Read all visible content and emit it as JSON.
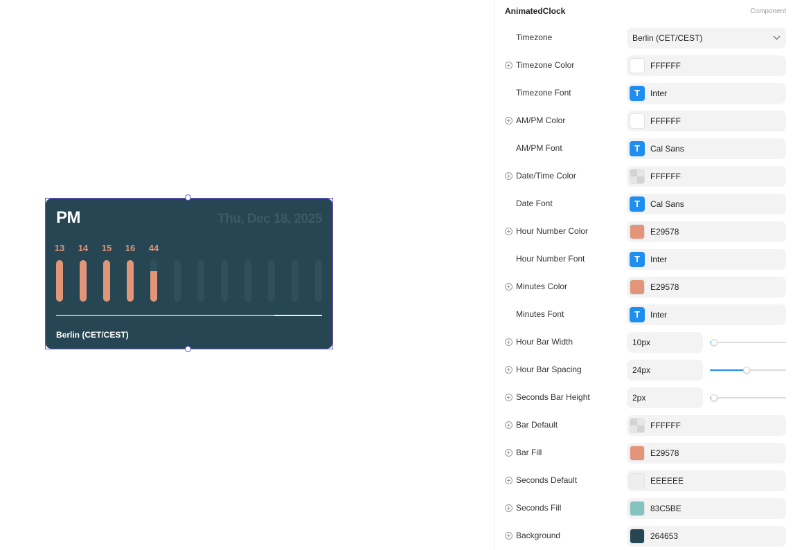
{
  "clock": {
    "ampm": "PM",
    "date": "Thu, Dec 18, 2025",
    "timezone": "Berlin (CET/CEST)",
    "background": "#264653",
    "date_color": "#3a5a66",
    "hour_color": "#E29578",
    "bar_default_color": "#2f4f5b",
    "bar_fill_color": "#E29578",
    "seconds_default_color": "#EEEEEE",
    "seconds_fill_color": "#83C5BE",
    "timezone_color": "#FFFFFF",
    "seconds_progress": 0.82,
    "hours": [
      {
        "label": "13",
        "fill": 1
      },
      {
        "label": "14",
        "fill": 1
      },
      {
        "label": "15",
        "fill": 1
      },
      {
        "label": "16",
        "fill": 1
      },
      {
        "label": "44",
        "fill": 0.73
      },
      {
        "label": "",
        "fill": 0
      },
      {
        "label": "",
        "fill": 0
      },
      {
        "label": "",
        "fill": 0
      },
      {
        "label": "",
        "fill": 0
      },
      {
        "label": "",
        "fill": 0
      },
      {
        "label": "",
        "fill": 0
      },
      {
        "label": "",
        "fill": 0
      }
    ]
  },
  "panel": {
    "title": "AnimatedClock",
    "type": "Component",
    "rows": [
      {
        "id": "timezone",
        "label": "Timezone",
        "kind": "select",
        "value": "Berlin (CET/CEST)",
        "plus": false
      },
      {
        "id": "timezone-color",
        "label": "Timezone Color",
        "kind": "color",
        "value": "FFFFFF",
        "swatch": "#FFFFFF",
        "plus": true
      },
      {
        "id": "timezone-font",
        "label": "Timezone Font",
        "kind": "font",
        "value": "Inter",
        "plus": false
      },
      {
        "id": "ampm-color",
        "label": "AM/PM Color",
        "kind": "color",
        "value": "FFFFFF",
        "swatch": "#FFFFFF",
        "plus": true
      },
      {
        "id": "ampm-font",
        "label": "AM/PM Font",
        "kind": "font",
        "value": "Cal Sans",
        "plus": false
      },
      {
        "id": "datetime-color",
        "label": "Date/Time Color",
        "kind": "color",
        "value": "FFFFFF",
        "swatch": "checker",
        "plus": true
      },
      {
        "id": "date-font",
        "label": "Date Font",
        "kind": "font",
        "value": "Cal Sans",
        "plus": false
      },
      {
        "id": "hour-number-color",
        "label": "Hour Number Color",
        "kind": "color",
        "value": "E29578",
        "swatch": "#E29578",
        "plus": true
      },
      {
        "id": "hour-number-font",
        "label": "Hour Number Font",
        "kind": "font",
        "value": "Inter",
        "plus": false
      },
      {
        "id": "minutes-color",
        "label": "Minutes Color",
        "kind": "color",
        "value": "E29578",
        "swatch": "#E29578",
        "plus": true
      },
      {
        "id": "minutes-font",
        "label": "Minutes Font",
        "kind": "font",
        "value": "Inter",
        "plus": false
      },
      {
        "id": "hour-bar-width",
        "label": "Hour Bar Width",
        "kind": "slider",
        "value": "10px",
        "level": 0.05,
        "plus": true
      },
      {
        "id": "hour-bar-spacing",
        "label": "Hour Bar Spacing",
        "kind": "slider",
        "value": "24px",
        "level": 0.48,
        "plus": true
      },
      {
        "id": "seconds-bar-height",
        "label": "Seconds Bar Height",
        "kind": "slider",
        "value": "2px",
        "level": 0.05,
        "plus": true
      },
      {
        "id": "bar-default",
        "label": "Bar Default",
        "kind": "color",
        "value": "FFFFFF",
        "swatch": "checker",
        "plus": true
      },
      {
        "id": "bar-fill",
        "label": "Bar Fill",
        "kind": "color",
        "value": "E29578",
        "swatch": "#E29578",
        "plus": true
      },
      {
        "id": "seconds-default",
        "label": "Seconds Default",
        "kind": "color",
        "value": "EEEEEE",
        "swatch": "#EEEEEE",
        "plus": true
      },
      {
        "id": "seconds-fill",
        "label": "Seconds Fill",
        "kind": "color",
        "value": "83C5BE",
        "swatch": "#83C5BE",
        "plus": true
      },
      {
        "id": "background",
        "label": "Background",
        "kind": "color",
        "value": "264653",
        "swatch": "#264653",
        "plus": true
      }
    ]
  }
}
